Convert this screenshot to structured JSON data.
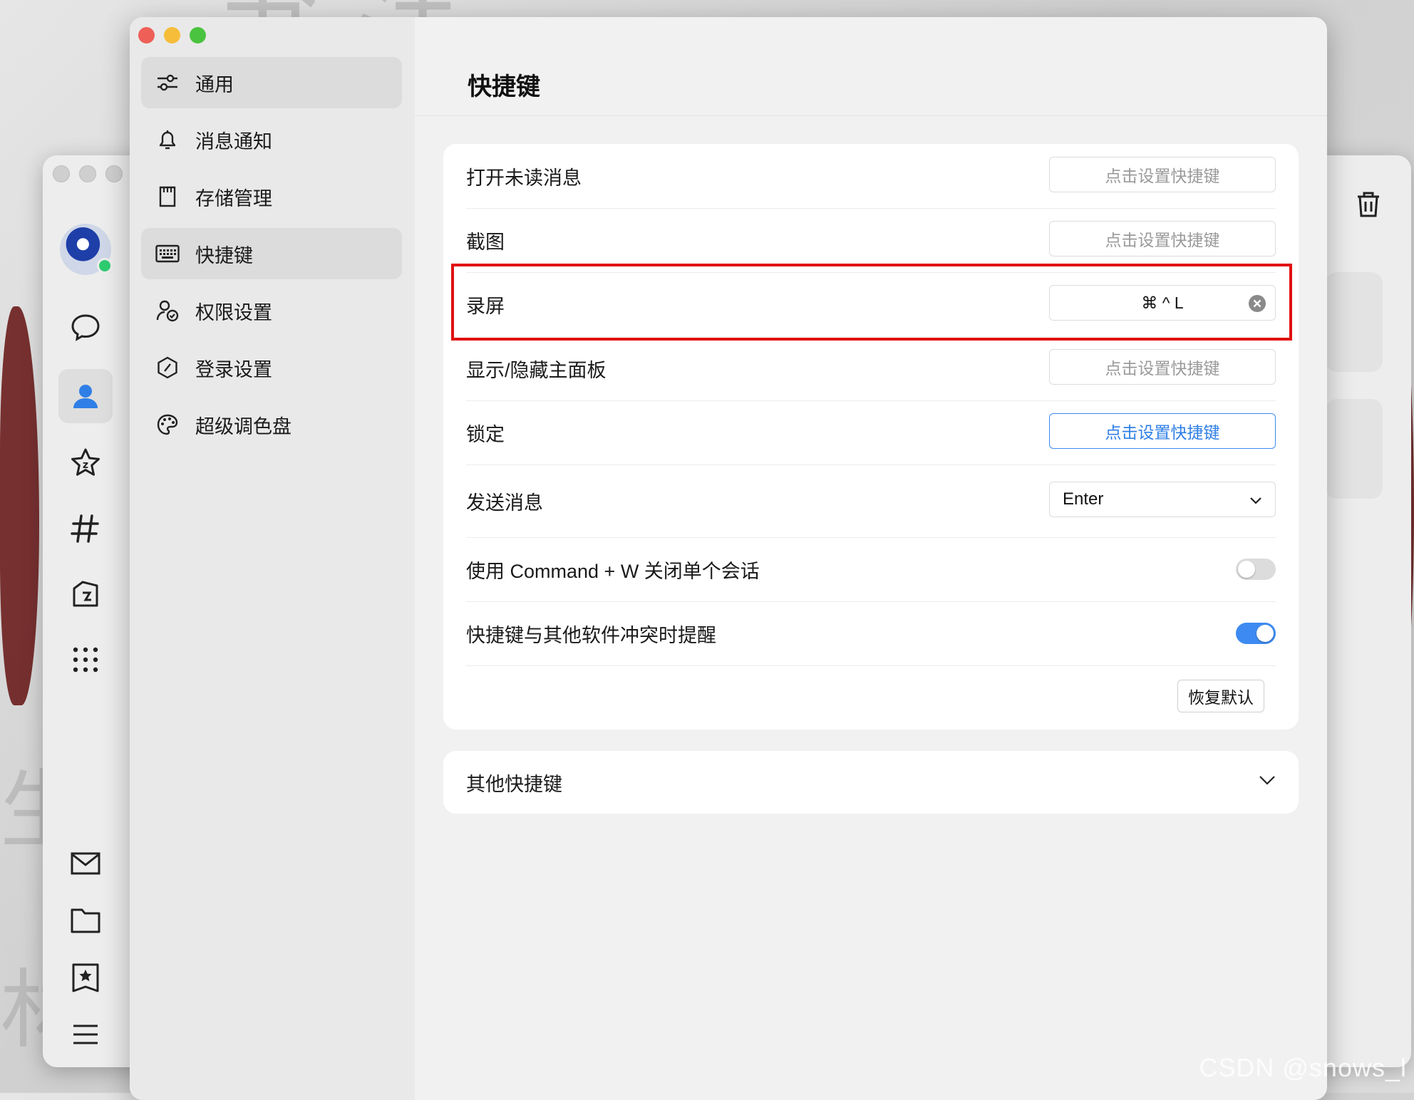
{
  "window_title": "快捷键",
  "sidebar": {
    "items": [
      {
        "label": "通用"
      },
      {
        "label": "消息通知"
      },
      {
        "label": "存储管理"
      },
      {
        "label": "快捷键"
      },
      {
        "label": "权限设置"
      },
      {
        "label": "登录设置"
      },
      {
        "label": "超级调色盘"
      }
    ]
  },
  "shortcuts": {
    "rows": [
      {
        "label": "打开未读消息",
        "value": "点击设置快捷键"
      },
      {
        "label": "截图",
        "value": "点击设置快捷键"
      },
      {
        "label": "录屏",
        "value": "⌘ ^ L"
      },
      {
        "label": "显示/隐藏主面板",
        "value": "点击设置快捷键"
      },
      {
        "label": "锁定",
        "value": "点击设置快捷键"
      }
    ],
    "send_message": {
      "label": "发送消息",
      "value": "Enter"
    },
    "cmd_w": {
      "label": "使用 Command + W 关闭单个会话",
      "enabled": false
    },
    "conflict": {
      "label": "快捷键与其他软件冲突时提醒",
      "enabled": true
    },
    "reset_label": "恢复默认"
  },
  "other": {
    "label": "其他快捷键"
  },
  "colors": {
    "accent": "#3d8bf2",
    "highlight": "#e11010",
    "traffic_close": "#ee5f57",
    "traffic_min": "#f6bd3a",
    "traffic_max": "#4ac33f"
  },
  "watermark": "CSDN @snows_l"
}
